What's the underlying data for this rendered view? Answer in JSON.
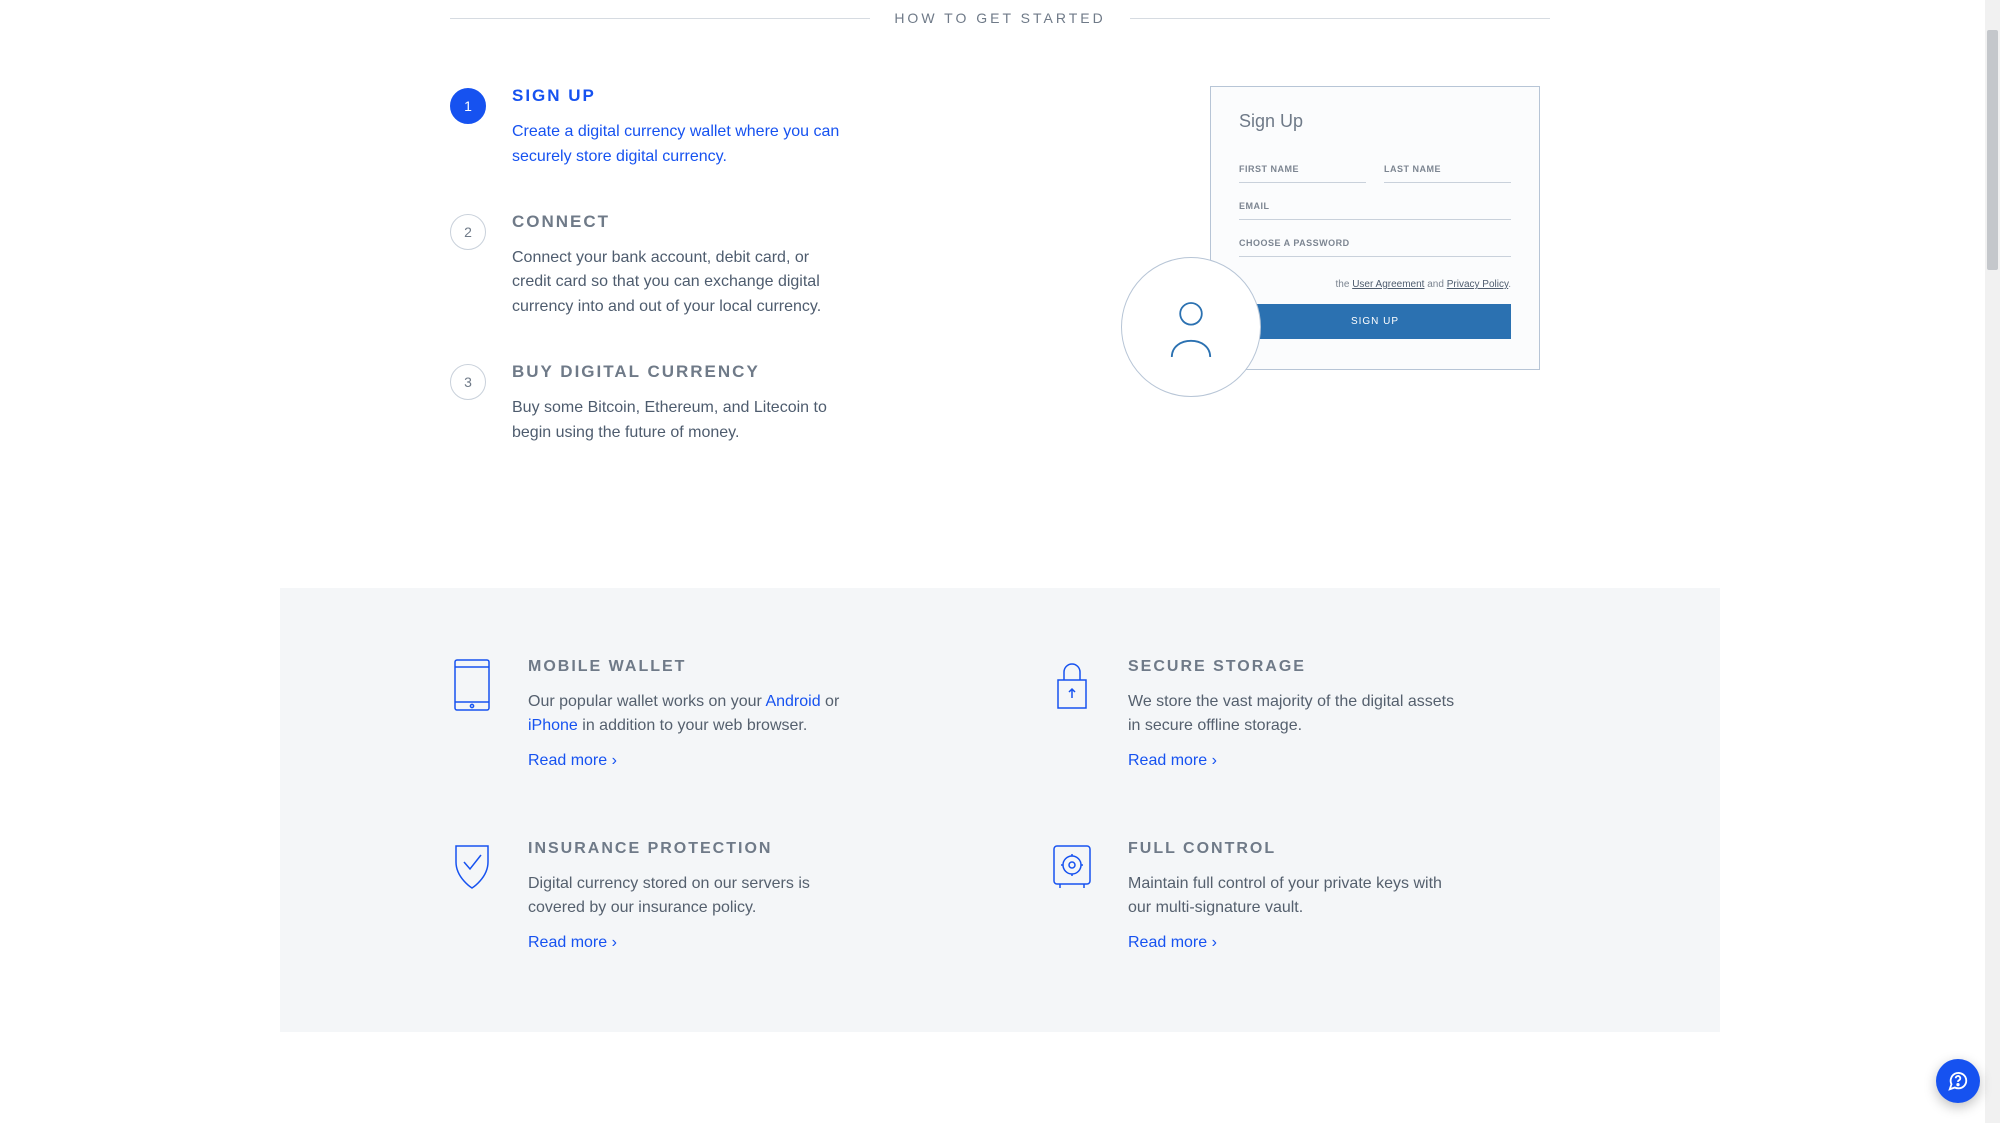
{
  "section_title": "HOW TO GET STARTED",
  "steps": [
    {
      "num": "1",
      "title": "SIGN UP",
      "desc": "Create a digital currency wallet where you can securely store digital currency.",
      "active": true
    },
    {
      "num": "2",
      "title": "CONNECT",
      "desc": "Connect your bank account, debit card, or credit card so that you can exchange digital currency into and out of your local currency.",
      "active": false
    },
    {
      "num": "3",
      "title": "BUY DIGITAL CURRENCY",
      "desc": "Buy some Bitcoin, Ethereum, and Litecoin to begin using the future of money.",
      "active": false
    }
  ],
  "signup_mock": {
    "title": "Sign Up",
    "first_name_label": "FIRST NAME",
    "last_name_label": "LAST NAME",
    "email_label": "EMAIL",
    "password_label": "CHOOSE A PASSWORD",
    "consent_the": "the ",
    "consent_ua": "User Agreement",
    "consent_and": " and ",
    "consent_pp": "Privacy Policy",
    "consent_period": ".",
    "button": "SIGN UP"
  },
  "features": [
    {
      "icon": "tablet-icon",
      "title": "MOBILE WALLET",
      "desc_pre": "Our popular wallet works on your ",
      "link1": "Android",
      "desc_mid": " or ",
      "link2": "iPhone",
      "desc_post": " in addition to your web browser.",
      "readmore": "Read more ›"
    },
    {
      "icon": "lock-icon",
      "title": "SECURE STORAGE",
      "desc_pre": "We store the vast majority of the digital assets in secure offline storage.",
      "link1": "",
      "desc_mid": "",
      "link2": "",
      "desc_post": "",
      "readmore": "Read more ›"
    },
    {
      "icon": "shield-check-icon",
      "title": "INSURANCE PROTECTION",
      "desc_pre": "Digital currency stored on our servers is covered by our insurance policy.",
      "link1": "",
      "desc_mid": "",
      "link2": "",
      "desc_post": "",
      "readmore": "Read more ›"
    },
    {
      "icon": "vault-icon",
      "title": "FULL CONTROL",
      "desc_pre": "Maintain full control of your private keys with our multi-signature vault.",
      "link1": "",
      "desc_mid": "",
      "link2": "",
      "desc_post": "",
      "readmore": "Read more ›"
    }
  ]
}
